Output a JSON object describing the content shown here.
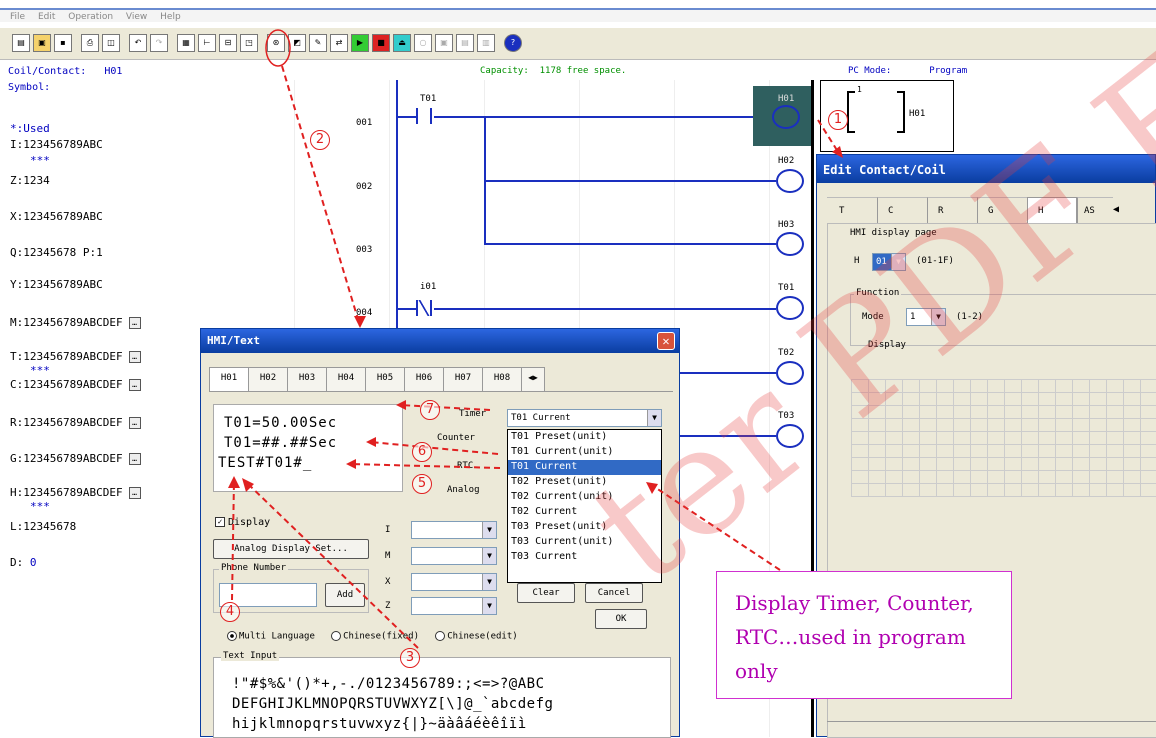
{
  "menu": [
    "File",
    "Edit",
    "Operation",
    "View",
    "Help"
  ],
  "status": {
    "coil_label": "Coil/Contact:",
    "coil_value": "H01",
    "symbol_label": "Symbol:",
    "capacity_label": "Capacity:",
    "capacity_value": "1178 free space.",
    "pc_mode_label": "PC Mode:",
    "pc_mode_value": "Program"
  },
  "left_panel": {
    "used": "*:Used",
    "rows": [
      {
        "text": "I:123456789ABC",
        "has_btn": false
      },
      {
        "text": "***",
        "has_btn": false
      },
      {
        "text": "Z:1234",
        "has_btn": false
      },
      {
        "text": "X:123456789ABC",
        "has_btn": false
      },
      {
        "text": "Q:12345678 P:1",
        "has_btn": false
      },
      {
        "text": "Y:123456789ABC",
        "has_btn": false
      },
      {
        "text": "M:123456789ABCDEF",
        "has_btn": true
      },
      {
        "text": "T:123456789ABCDEF",
        "has_btn": true
      },
      {
        "text": "***",
        "has_btn": false
      },
      {
        "text": "C:123456789ABCDEF",
        "has_btn": true
      },
      {
        "text": "R:123456789ABCDEF",
        "has_btn": true
      },
      {
        "text": "G:123456789ABCDEF",
        "has_btn": true
      },
      {
        "text": "H:123456789ABCDEF",
        "has_btn": true
      },
      {
        "text": "***",
        "has_btn": false
      },
      {
        "text": "L:12345678",
        "has_btn": false
      },
      {
        "text": "D:",
        "has_btn": false
      }
    ],
    "d_value": "0"
  },
  "ladder": {
    "rungs": [
      "001",
      "002",
      "003",
      "004"
    ],
    "contacts": [
      "T01",
      "i01"
    ],
    "coils": [
      "H01",
      "H02",
      "H03",
      "T01",
      "T02",
      "T03"
    ],
    "preview_label": "H01",
    "preview_index": "1"
  },
  "hmi": {
    "title": "HMI/Text",
    "tabs": [
      "H01",
      "H02",
      "H03",
      "H04",
      "H05",
      "H06",
      "H07",
      "H08"
    ],
    "lcd_lines": [
      "T01=50.00Sec",
      "T01=##.##Sec",
      "TEST#T01#_"
    ],
    "side_labels": [
      "Timer",
      "Counter",
      "RTC",
      "Analog"
    ],
    "timer_selected": "T01 Current",
    "dropdown": [
      "T01 Preset(unit)",
      "T01 Current(unit)",
      "T01 Current",
      "T02 Preset(unit)",
      "T02 Current(unit)",
      "T02 Current",
      "T03 Preset(unit)",
      "T03 Current(unit)",
      "T03 Current"
    ],
    "dropdown_selected_index": 2,
    "display_label": "Display",
    "analog_btn": "Analog Display Set...",
    "phone_label": "Phone Number",
    "add_btn": "Add",
    "io_labels": [
      "I",
      "M",
      "X",
      "Z"
    ],
    "clear_btn": "Clear",
    "cancel_btn": "Cancel",
    "ok_btn": "OK",
    "lang_options": [
      "Multi Language",
      "Chinese(fixed)",
      "Chinese(edit)"
    ],
    "text_input_label": "Text Input",
    "text_input_lines": [
      " !\"#$%&'()*+,-./0123456789:;<=>?@ABC",
      "DEFGHIJKLMNOPQRSTUVWXYZ[\\]@_`abcdefg",
      "hijklmnopqrstuvwxyz{|}~äàâáéèêîïì"
    ]
  },
  "edit": {
    "title": "Edit Contact/Coil",
    "tabs": [
      "T",
      "C",
      "R",
      "G",
      "H",
      "AS"
    ],
    "hmi_page_label": "HMI display page",
    "h_label": "H",
    "h_value": "01",
    "h_range": "(01-1F)",
    "function_label": "Function",
    "mode_label": "Mode",
    "mode_value": "1",
    "mode_range": "(1-2)",
    "display_label": "Display"
  },
  "annotations": [
    "1",
    "2",
    "3",
    "4",
    "5",
    "6",
    "7"
  ],
  "callout": "Display Timer, Counter, RTC…used in program only",
  "watermark": "ter PDF E"
}
